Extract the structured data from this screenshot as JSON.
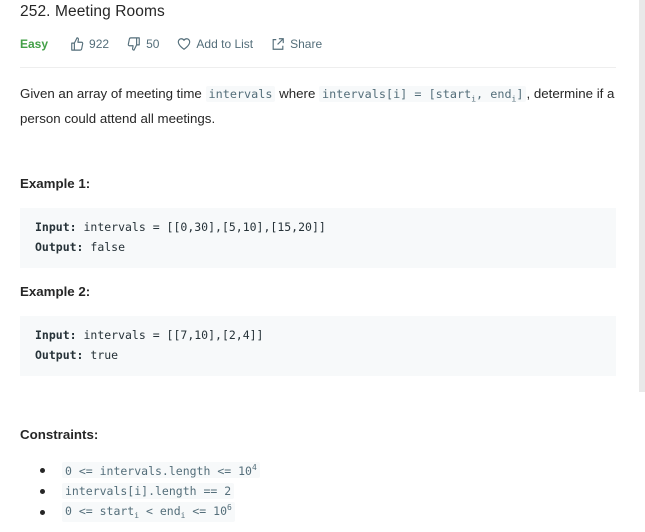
{
  "problem": {
    "title": "252. Meeting Rooms",
    "difficulty": "Easy",
    "likes": "922",
    "dislikes": "50",
    "add_to_list": "Add to List",
    "share": "Share"
  },
  "description": {
    "part1": "Given an array of meeting time ",
    "code1": "intervals",
    "part2": " where ",
    "code2": "intervals[i] = [start",
    "code2_sub1": "i",
    "code2_mid": ", end",
    "code2_sub2": "i",
    "code2_end": "]",
    "part3": ", determine if a person could attend all meetings."
  },
  "examples": [
    {
      "title": "Example 1:",
      "input_label": "Input:",
      "input_value": " intervals = [[0,30],[5,10],[15,20]]",
      "output_label": "Output:",
      "output_value": " false"
    },
    {
      "title": "Example 2:",
      "input_label": "Input:",
      "input_value": " intervals = [[7,10],[2,4]]",
      "output_label": "Output:",
      "output_value": " true"
    }
  ],
  "constraints": {
    "title": "Constraints:",
    "items": [
      {
        "text": "0 <= intervals.length <= 10",
        "sup": "4"
      },
      {
        "text": "intervals[i].length == 2"
      },
      {
        "pre": "0 <= start",
        "sub1": "i",
        "mid": " < end",
        "sub2": "i",
        "post": " <= 10",
        "sup": "6"
      }
    ]
  },
  "icons": {
    "likes": "thumbs-up-icon",
    "dislikes": "thumbs-down-icon",
    "add_to_list": "heart-icon",
    "share": "share-icon"
  },
  "colors": {
    "easy": "#43a047",
    "meta_text": "#546e7a",
    "code_bg": "#f7f9fa"
  }
}
